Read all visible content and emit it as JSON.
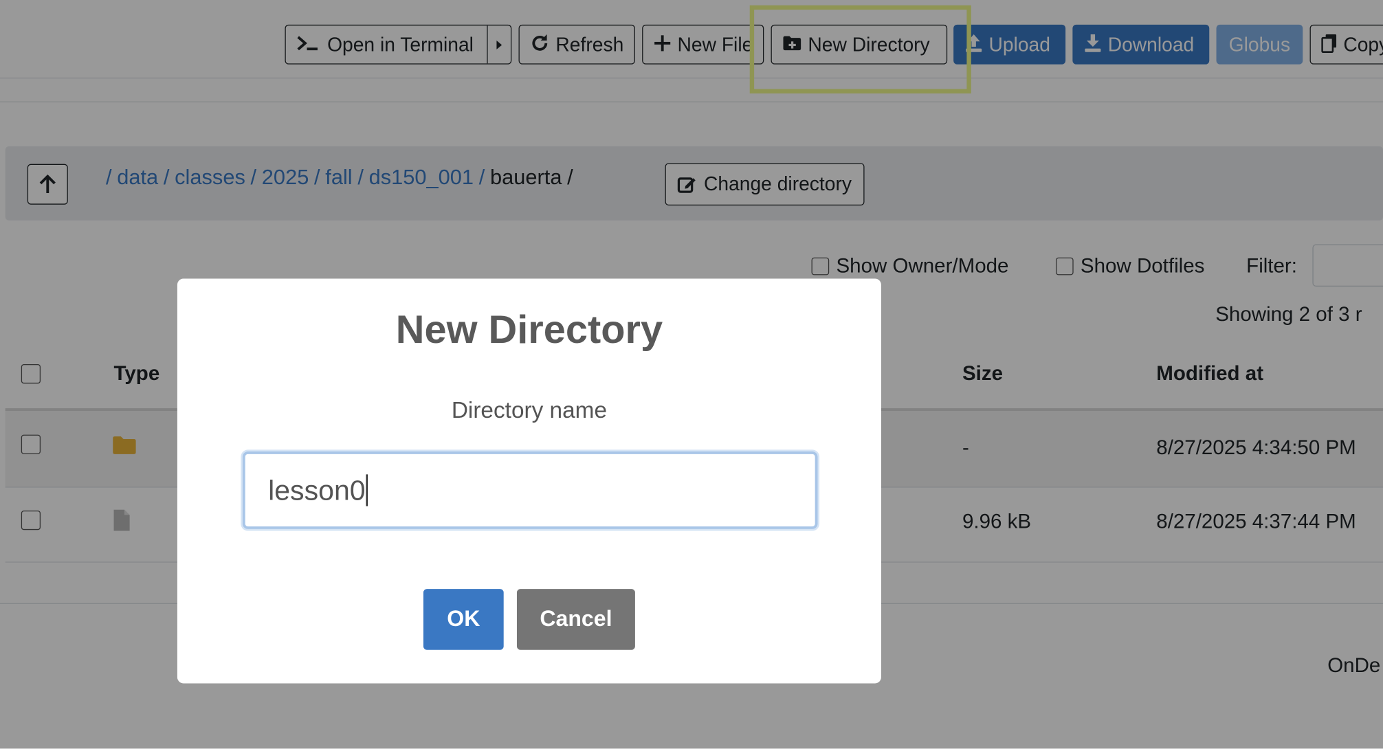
{
  "toolbar": {
    "open_terminal": "Open in Terminal",
    "refresh": "Refresh",
    "new_file": "New File",
    "new_directory": "New Directory",
    "upload": "Upload",
    "download": "Download",
    "globus": "Globus",
    "copy": "Copy"
  },
  "breadcrumb": {
    "parts": [
      "data",
      "classes",
      "2025",
      "fall",
      "ds150_001"
    ],
    "current": "bauerta",
    "change_directory": "Change directory"
  },
  "options": {
    "show_owner_mode": "Show Owner/Mode",
    "show_dotfiles": "Show Dotfiles",
    "filter_label": "Filter:",
    "showing": "Showing 2 of 3 r"
  },
  "table": {
    "headers": {
      "type": "Type",
      "size": "Size",
      "modified": "Modified at"
    },
    "rows": [
      {
        "type_icon": "folder-icon",
        "size": "-",
        "modified": "8/27/2025 4:34:50 PM"
      },
      {
        "type_icon": "file-icon",
        "size": "9.96 kB",
        "modified": "8/27/2025 4:37:44 PM"
      }
    ]
  },
  "footer": {
    "text": "OnDe"
  },
  "modal": {
    "title": "New Directory",
    "label": "Directory name",
    "value": "lesson0",
    "ok": "OK",
    "cancel": "Cancel"
  },
  "colors": {
    "primary": "#3a78c3",
    "highlight": "#eef98b",
    "folder": "#e8b23a"
  }
}
